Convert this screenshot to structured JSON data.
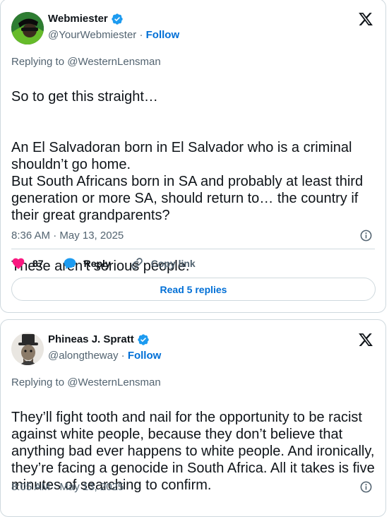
{
  "tweets": [
    {
      "display_name": "Webmiester",
      "handle": "@YourWebmiester",
      "separator": " · ",
      "follow_label": "Follow",
      "replying_to": "Replying to @WesternLensman",
      "paragraphs": [
        "So to get this straight…",
        "An El Salvadoran born in El Salvador who is a criminal shouldn’t go home.\nBut South Africans born in SA and probably at least third generation or more SA, should return to… the country if their great grandparents?",
        "These aren’t serious people."
      ],
      "timestamp": "8:36 AM · May 13, 2025",
      "likes": "87",
      "reply_label": "Reply",
      "copy_link_label": "Copy link",
      "read_replies_label": "Read 5 replies"
    },
    {
      "display_name": "Phineas J. Spratt",
      "handle": "@alongtheway",
      "separator": " · ",
      "follow_label": "Follow",
      "replying_to": "Replying to @WesternLensman",
      "paragraphs": [
        "They’ll fight tooth and nail for the opportunity to be racist against white people, because they don’t believe that anything bad ever happens to white people. And ironically, they’re facing a genocide in South Africa. All it takes is five minutes of searching to confirm."
      ],
      "timestamp": "8:05 AM · May 13, 2025"
    }
  ],
  "colors": {
    "verified": "#1d9bf0",
    "link": "#006fd6",
    "like": "#f91880",
    "reply": "#1d9bf0",
    "muted": "#536471",
    "border": "#cfd9de"
  },
  "icons": {
    "verified": "verified-badge-icon",
    "platform": "x-logo-icon",
    "info": "info-icon",
    "like": "heart-icon",
    "reply": "speech-bubble-icon",
    "copy_link": "link-icon"
  }
}
